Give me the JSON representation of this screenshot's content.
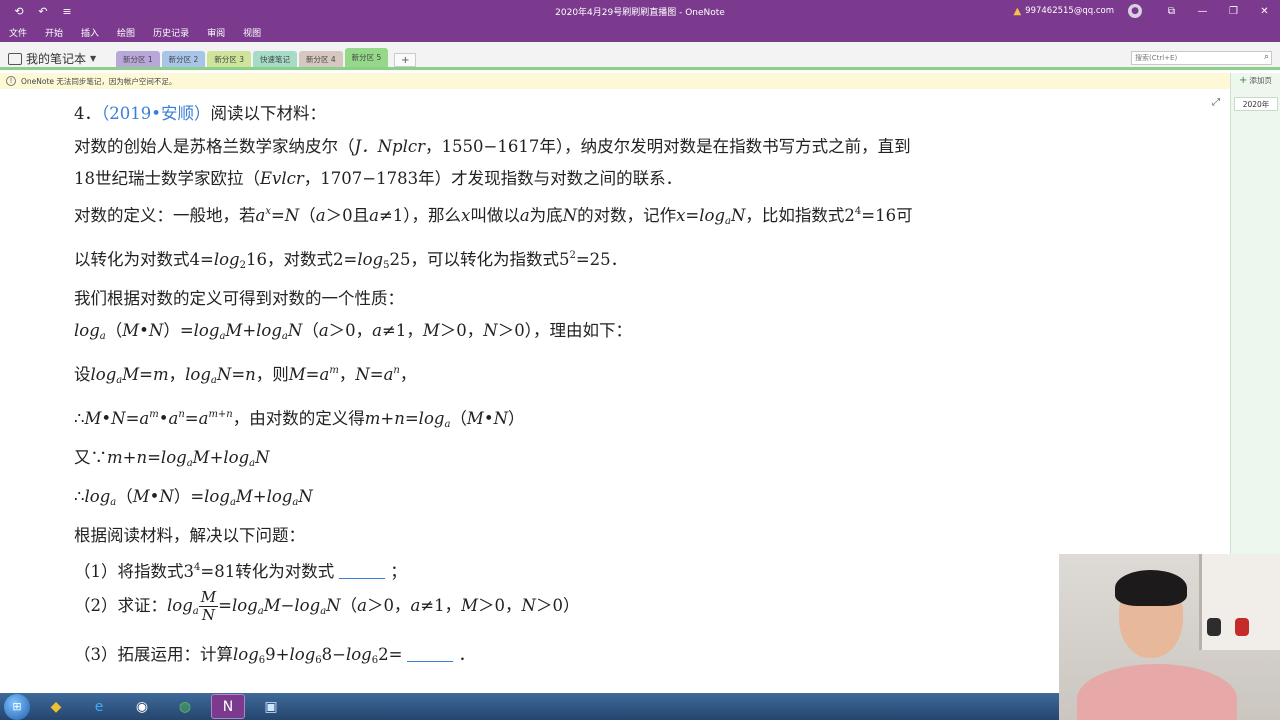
{
  "window": {
    "title": "2020年4月29号刷刷刷直播图 - OneNote",
    "user": "997462515@qq.com"
  },
  "menu": [
    "文件",
    "开始",
    "插入",
    "绘图",
    "历史记录",
    "审阅",
    "视图"
  ],
  "notebook": {
    "name": "我的笔记本"
  },
  "sections": [
    {
      "label": "新分区 1",
      "color": "#b9a7d9"
    },
    {
      "label": "新分区 2",
      "color": "#a8c4e8"
    },
    {
      "label": "新分区 3",
      "color": "#cfe39a"
    },
    {
      "label": "快速笔记",
      "color": "#a6dbc8"
    },
    {
      "label": "新分区 4",
      "color": "#d6c8c0"
    },
    {
      "label": "新分区 5",
      "color": "#96d88a"
    }
  ],
  "search": {
    "placeholder": "搜索(Ctrl+E)"
  },
  "notification": {
    "text": "OneNote 无法同步笔记，因为帐户空间不足。"
  },
  "pages_pane": {
    "add_page": "添加页",
    "pages": [
      "2020年"
    ]
  },
  "content": {
    "q_number": "4．",
    "q_source": "（2019•安顺）",
    "q_intro": "阅读以下材料：",
    "p1a": "对数的创始人是苏格兰数学家纳皮尔（",
    "p1b": "J．Nplcr",
    "p1c": "，1550−1617年），纳皮尔发明对数是在指数书写方式之前，直到",
    "p2a": "18世纪瑞士数学家欧拉（",
    "p2b": "Evlcr",
    "p2c": "，1707−1783年）才发现指数与对数之间的联系．",
    "def_prefix": "对数的定义：一般地，若",
    "def_tail": "可",
    "def2_prefix": "以转化为对数式",
    "prop_intro": "我们根据对数的定义可得到对数的一个性质：",
    "reason": "，理由如下：",
    "hence_text": "，由对数的定义得",
    "task_intro": "根据阅读材料，解决以下问题：",
    "q1_prefix": "（1）将指数式",
    "q1_mid": "转化为对数式",
    "q2_prefix": "（2）求证：",
    "q3_prefix": "（3）拓展运用：计算"
  }
}
